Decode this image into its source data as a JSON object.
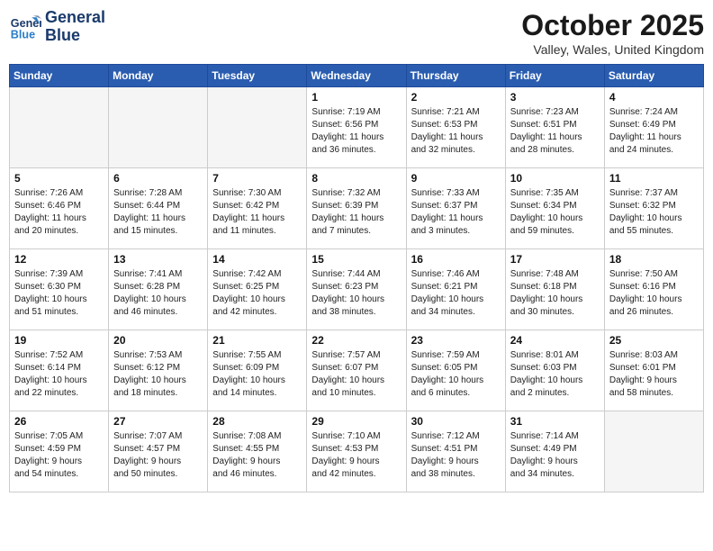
{
  "header": {
    "logo_line1": "General",
    "logo_line2": "Blue",
    "month": "October 2025",
    "location": "Valley, Wales, United Kingdom"
  },
  "weekdays": [
    "Sunday",
    "Monday",
    "Tuesday",
    "Wednesday",
    "Thursday",
    "Friday",
    "Saturday"
  ],
  "weeks": [
    [
      {
        "day": "",
        "info": ""
      },
      {
        "day": "",
        "info": ""
      },
      {
        "day": "",
        "info": ""
      },
      {
        "day": "1",
        "info": "Sunrise: 7:19 AM\nSunset: 6:56 PM\nDaylight: 11 hours\nand 36 minutes."
      },
      {
        "day": "2",
        "info": "Sunrise: 7:21 AM\nSunset: 6:53 PM\nDaylight: 11 hours\nand 32 minutes."
      },
      {
        "day": "3",
        "info": "Sunrise: 7:23 AM\nSunset: 6:51 PM\nDaylight: 11 hours\nand 28 minutes."
      },
      {
        "day": "4",
        "info": "Sunrise: 7:24 AM\nSunset: 6:49 PM\nDaylight: 11 hours\nand 24 minutes."
      }
    ],
    [
      {
        "day": "5",
        "info": "Sunrise: 7:26 AM\nSunset: 6:46 PM\nDaylight: 11 hours\nand 20 minutes."
      },
      {
        "day": "6",
        "info": "Sunrise: 7:28 AM\nSunset: 6:44 PM\nDaylight: 11 hours\nand 15 minutes."
      },
      {
        "day": "7",
        "info": "Sunrise: 7:30 AM\nSunset: 6:42 PM\nDaylight: 11 hours\nand 11 minutes."
      },
      {
        "day": "8",
        "info": "Sunrise: 7:32 AM\nSunset: 6:39 PM\nDaylight: 11 hours\nand 7 minutes."
      },
      {
        "day": "9",
        "info": "Sunrise: 7:33 AM\nSunset: 6:37 PM\nDaylight: 11 hours\nand 3 minutes."
      },
      {
        "day": "10",
        "info": "Sunrise: 7:35 AM\nSunset: 6:34 PM\nDaylight: 10 hours\nand 59 minutes."
      },
      {
        "day": "11",
        "info": "Sunrise: 7:37 AM\nSunset: 6:32 PM\nDaylight: 10 hours\nand 55 minutes."
      }
    ],
    [
      {
        "day": "12",
        "info": "Sunrise: 7:39 AM\nSunset: 6:30 PM\nDaylight: 10 hours\nand 51 minutes."
      },
      {
        "day": "13",
        "info": "Sunrise: 7:41 AM\nSunset: 6:28 PM\nDaylight: 10 hours\nand 46 minutes."
      },
      {
        "day": "14",
        "info": "Sunrise: 7:42 AM\nSunset: 6:25 PM\nDaylight: 10 hours\nand 42 minutes."
      },
      {
        "day": "15",
        "info": "Sunrise: 7:44 AM\nSunset: 6:23 PM\nDaylight: 10 hours\nand 38 minutes."
      },
      {
        "day": "16",
        "info": "Sunrise: 7:46 AM\nSunset: 6:21 PM\nDaylight: 10 hours\nand 34 minutes."
      },
      {
        "day": "17",
        "info": "Sunrise: 7:48 AM\nSunset: 6:18 PM\nDaylight: 10 hours\nand 30 minutes."
      },
      {
        "day": "18",
        "info": "Sunrise: 7:50 AM\nSunset: 6:16 PM\nDaylight: 10 hours\nand 26 minutes."
      }
    ],
    [
      {
        "day": "19",
        "info": "Sunrise: 7:52 AM\nSunset: 6:14 PM\nDaylight: 10 hours\nand 22 minutes."
      },
      {
        "day": "20",
        "info": "Sunrise: 7:53 AM\nSunset: 6:12 PM\nDaylight: 10 hours\nand 18 minutes."
      },
      {
        "day": "21",
        "info": "Sunrise: 7:55 AM\nSunset: 6:09 PM\nDaylight: 10 hours\nand 14 minutes."
      },
      {
        "day": "22",
        "info": "Sunrise: 7:57 AM\nSunset: 6:07 PM\nDaylight: 10 hours\nand 10 minutes."
      },
      {
        "day": "23",
        "info": "Sunrise: 7:59 AM\nSunset: 6:05 PM\nDaylight: 10 hours\nand 6 minutes."
      },
      {
        "day": "24",
        "info": "Sunrise: 8:01 AM\nSunset: 6:03 PM\nDaylight: 10 hours\nand 2 minutes."
      },
      {
        "day": "25",
        "info": "Sunrise: 8:03 AM\nSunset: 6:01 PM\nDaylight: 9 hours\nand 58 minutes."
      }
    ],
    [
      {
        "day": "26",
        "info": "Sunrise: 7:05 AM\nSunset: 4:59 PM\nDaylight: 9 hours\nand 54 minutes."
      },
      {
        "day": "27",
        "info": "Sunrise: 7:07 AM\nSunset: 4:57 PM\nDaylight: 9 hours\nand 50 minutes."
      },
      {
        "day": "28",
        "info": "Sunrise: 7:08 AM\nSunset: 4:55 PM\nDaylight: 9 hours\nand 46 minutes."
      },
      {
        "day": "29",
        "info": "Sunrise: 7:10 AM\nSunset: 4:53 PM\nDaylight: 9 hours\nand 42 minutes."
      },
      {
        "day": "30",
        "info": "Sunrise: 7:12 AM\nSunset: 4:51 PM\nDaylight: 9 hours\nand 38 minutes."
      },
      {
        "day": "31",
        "info": "Sunrise: 7:14 AM\nSunset: 4:49 PM\nDaylight: 9 hours\nand 34 minutes."
      },
      {
        "day": "",
        "info": ""
      }
    ]
  ]
}
